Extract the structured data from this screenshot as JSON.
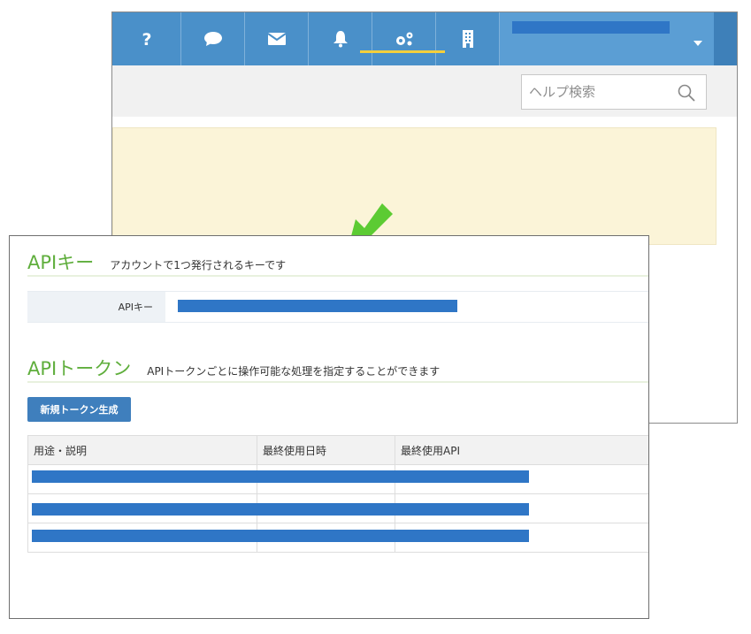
{
  "header": {
    "icons": [
      {
        "name": "help-icon",
        "glyph": "?"
      },
      {
        "name": "chat-icon",
        "glyph": "speech-bubble"
      },
      {
        "name": "mail-icon",
        "glyph": "envelope"
      },
      {
        "name": "bell-icon",
        "glyph": "bell"
      },
      {
        "name": "settings-icon",
        "glyph": "gears"
      },
      {
        "name": "building-icon",
        "glyph": "building"
      }
    ],
    "active_item": "settings-icon",
    "account_dropdown_icon": "caret-down"
  },
  "help_search": {
    "placeholder": "ヘルプ検索",
    "icon": "search-icon"
  },
  "colors": {
    "topbar": "#4a90c9",
    "accent_underline": "#f3cf3c",
    "section_title": "#5fae3c",
    "primary_button": "#3f7fbd",
    "redaction": "#2f76c6",
    "notice": "#fbf4d8",
    "arrow": "#5ccb33"
  },
  "api_key_section": {
    "title": "APIキー",
    "description": "アカウントで1つ発行されるキーです",
    "row_label": "APIキー"
  },
  "api_token_section": {
    "title": "APIトークン",
    "description": "APIトークンごとに操作可能な処理を指定することができます",
    "new_button_label": "新規トークン生成",
    "columns": [
      "用途・説明",
      "最終使用日時",
      "最終使用API"
    ]
  }
}
